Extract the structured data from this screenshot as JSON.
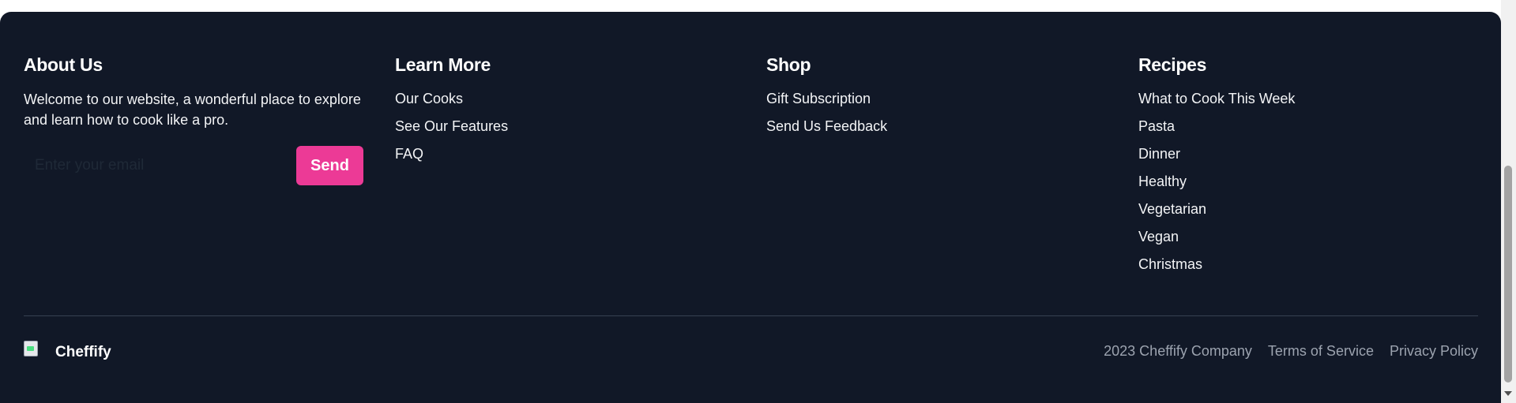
{
  "footer": {
    "about": {
      "title": "About Us",
      "text": "Welcome to our website, a wonderful place to explore and learn how to cook like a pro.",
      "email_placeholder": "Enter your email",
      "email_value": "",
      "send_label": "Send"
    },
    "learn_more": {
      "title": "Learn More",
      "items": [
        "Our Cooks",
        "See Our Features",
        "FAQ"
      ]
    },
    "shop": {
      "title": "Shop",
      "items": [
        "Gift Subscription",
        "Send Us Feedback"
      ]
    },
    "recipes": {
      "title": "Recipes",
      "items": [
        "What to Cook This Week",
        "Pasta",
        "Dinner",
        "Healthy",
        "Vegetarian",
        "Vegan",
        "Christmas"
      ]
    },
    "brand": {
      "logo_icon": "broken-image-icon",
      "name": "Cheffify"
    },
    "bottom": {
      "copyright": "2023 Cheffify Company",
      "terms": "Terms of Service",
      "privacy": "Privacy Policy"
    }
  },
  "colors": {
    "footer_bg": "#111827",
    "accent": "#ec3a96",
    "muted_text": "#9ca3af"
  }
}
